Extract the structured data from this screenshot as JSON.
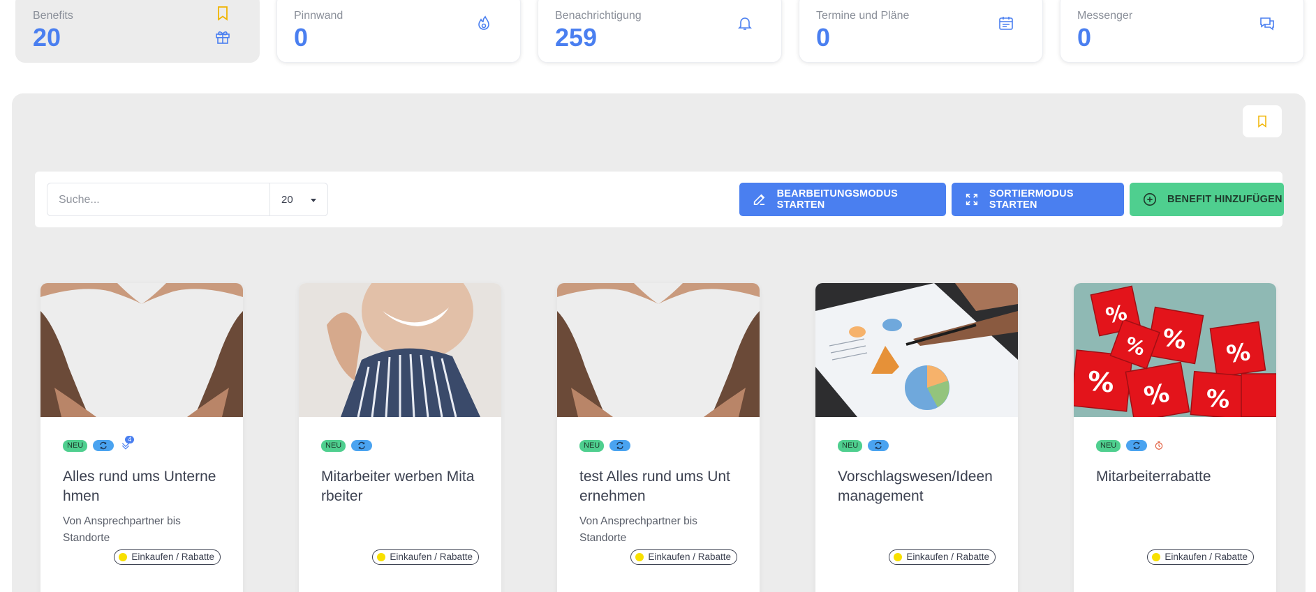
{
  "stats": [
    {
      "label": "Benefits",
      "value": "20",
      "icon": "gift-icon"
    },
    {
      "label": "Pinnwand",
      "value": "0",
      "icon": "flame-icon"
    },
    {
      "label": "Benachrichtigung",
      "value": "259",
      "icon": "bell-icon"
    },
    {
      "label": "Termine und Pläne",
      "value": "0",
      "icon": "calendar-icon"
    },
    {
      "label": "Messenger",
      "value": "0",
      "icon": "chat-icon"
    }
  ],
  "toolbar": {
    "search_placeholder": "Suche...",
    "per_page": "20",
    "edit_label": "BEARBEITUNGSMODUS STARTEN",
    "sort_label": "SORTIERMODUS STARTEN",
    "add_label": "BENEFIT HINZUFÜGEN"
  },
  "cards": [
    {
      "title": "Alles rund ums Unterne hmen",
      "desc": "Von Ansprechpartner bis Standorte",
      "badge_new": "NEU",
      "count": "4",
      "category": "Einkaufen / Rabatte"
    },
    {
      "title": "Mitarbeiter werben Mita rbeiter",
      "desc": "",
      "badge_new": "NEU",
      "category": "Einkaufen / Rabatte"
    },
    {
      "title": "test Alles rund ums Unt ernehmen",
      "desc": "Von Ansprechpartner bis Standorte",
      "badge_new": "NEU",
      "category": "Einkaufen / Rabatte"
    },
    {
      "title": "Vorschlagswesen/Ideen management",
      "desc": "",
      "badge_new": "NEU",
      "category": "Einkaufen / Rabatte"
    },
    {
      "title": "Mitarbeiterrabatte",
      "desc": "",
      "badge_new": "NEU",
      "category": "Einkaufen / Rabatte"
    }
  ],
  "colors": {
    "accent": "#4a7ff0",
    "green": "#4fcf8f",
    "bookmark": "#f0b400",
    "category_dot": "#f8e000"
  }
}
